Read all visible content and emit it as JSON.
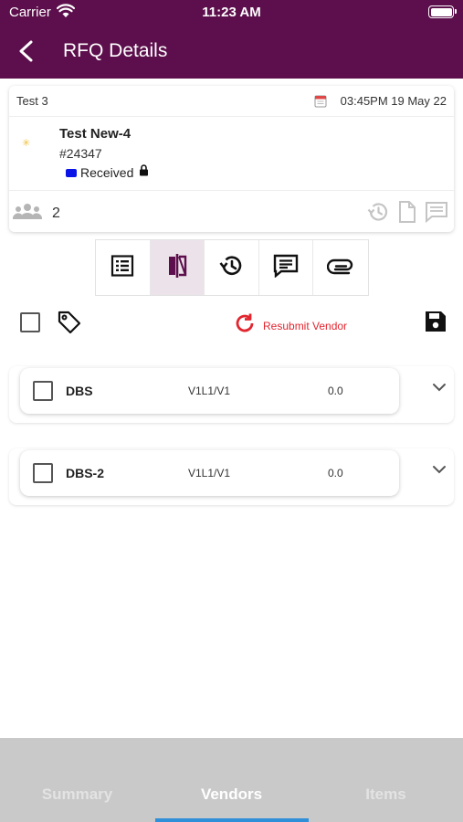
{
  "status_bar": {
    "carrier": "Carrier",
    "time": "11:23 AM"
  },
  "header": {
    "title": "RFQ Details"
  },
  "rfq": {
    "name": "Test 3",
    "datetime": "03:45PM 19 May 22",
    "item_title": "Test New-4",
    "item_number": "#24347",
    "status": "Received",
    "status_color": "#0a14e6",
    "user_count": "2"
  },
  "segments": [
    {
      "icon": "list-icon",
      "active": false
    },
    {
      "icon": "compare-icon",
      "active": true
    },
    {
      "icon": "history-icon",
      "active": false
    },
    {
      "icon": "comment-icon",
      "active": false
    },
    {
      "icon": "attachment-icon",
      "active": false
    }
  ],
  "actions": {
    "resubmit_label": "Resubmit Vendor"
  },
  "vendors": [
    {
      "name": "DBS",
      "version": "V1L1/V1",
      "value": "0.0"
    },
    {
      "name": "DBS-2",
      "version": "V1L1/V1",
      "value": "0.0"
    }
  ],
  "bottom_tabs": [
    {
      "label": "Summary",
      "active": false
    },
    {
      "label": "Vendors",
      "active": true
    },
    {
      "label": "Items",
      "active": false
    }
  ],
  "colors": {
    "brand": "#5c0f4c",
    "accent": "#e2262f",
    "tab_indicator": "#2f8fd8"
  }
}
